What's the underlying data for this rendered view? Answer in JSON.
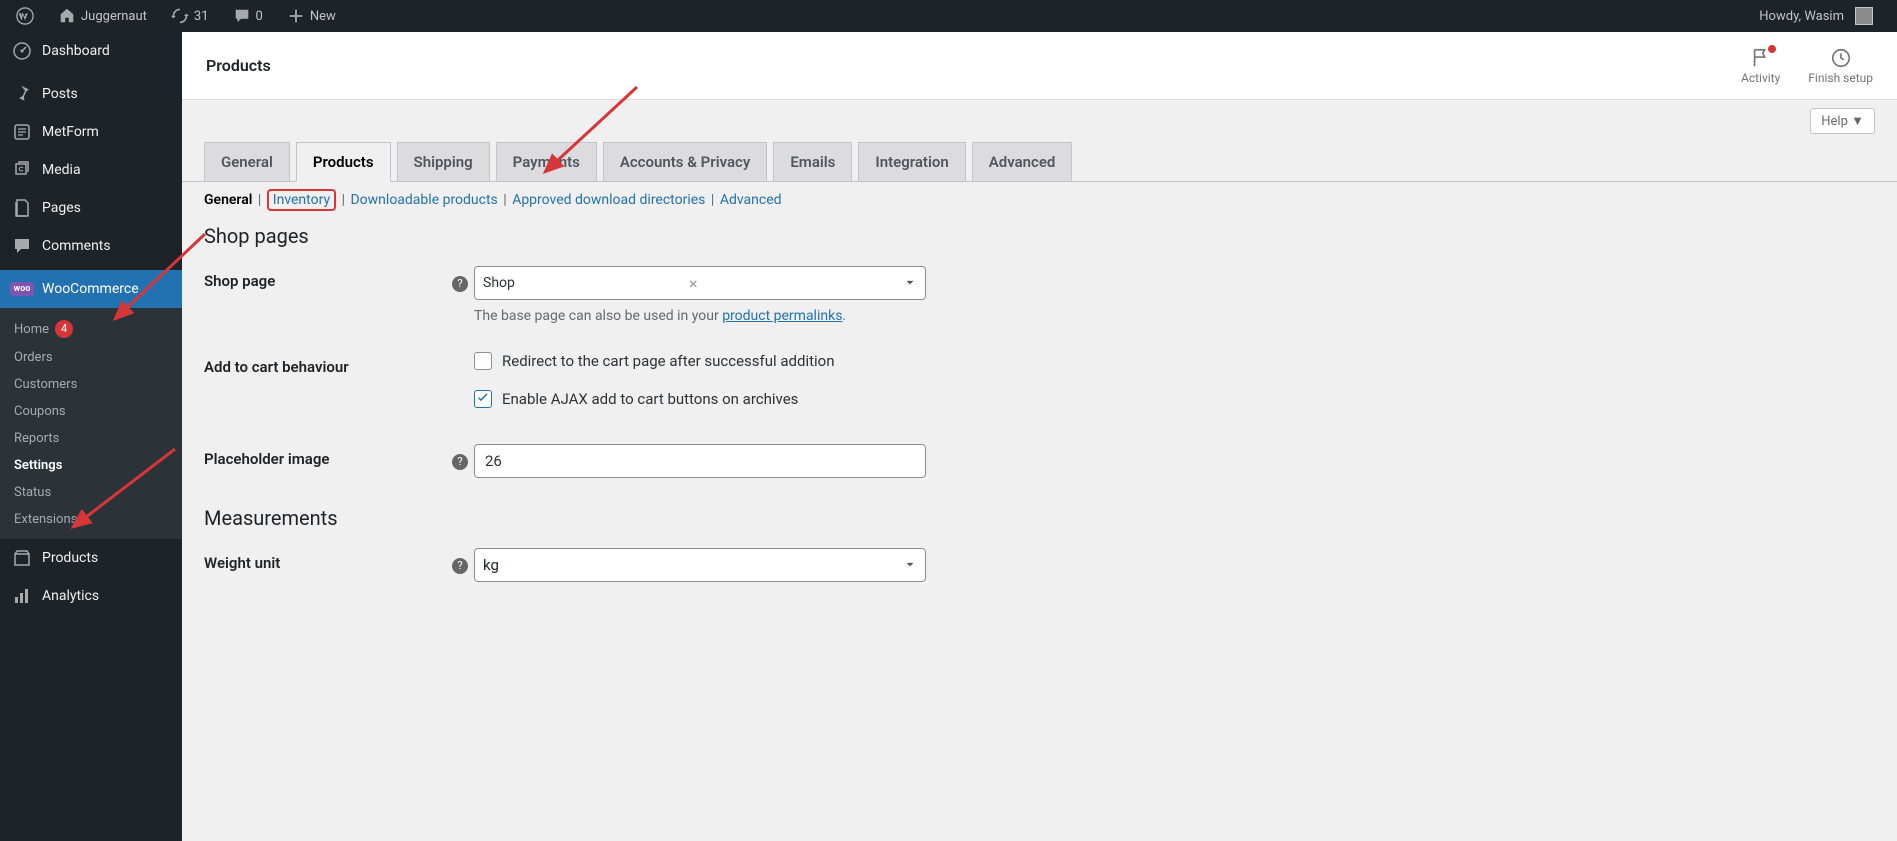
{
  "adminbar": {
    "site_name": "Juggernaut",
    "updates_count": "31",
    "comments_count": "0",
    "new_label": "New",
    "howdy": "Howdy, Wasim"
  },
  "sidebar": {
    "items": [
      {
        "label": "Dashboard",
        "icon": "dashboard"
      },
      {
        "label": "Posts",
        "icon": "pin"
      },
      {
        "label": "MetForm",
        "icon": "form"
      },
      {
        "label": "Media",
        "icon": "media"
      },
      {
        "label": "Pages",
        "icon": "pages"
      },
      {
        "label": "Comments",
        "icon": "comments"
      },
      {
        "label": "WooCommerce",
        "icon": "woo",
        "current": true
      }
    ],
    "woo_submenu": [
      {
        "label": "Home",
        "badge": "4"
      },
      {
        "label": "Orders"
      },
      {
        "label": "Customers"
      },
      {
        "label": "Coupons"
      },
      {
        "label": "Reports"
      },
      {
        "label": "Settings",
        "current": true
      },
      {
        "label": "Status"
      },
      {
        "label": "Extensions"
      }
    ],
    "after_items": [
      {
        "label": "Products",
        "icon": "products"
      },
      {
        "label": "Analytics",
        "icon": "analytics"
      }
    ]
  },
  "header": {
    "title": "Products",
    "activity": "Activity",
    "finish": "Finish setup"
  },
  "help_label": "Help ▼",
  "tabs": [
    "General",
    "Products",
    "Shipping",
    "Payments",
    "Accounts & Privacy",
    "Emails",
    "Integration",
    "Advanced"
  ],
  "active_tab": "Products",
  "subtabs": {
    "general": "General",
    "inventory": "Inventory",
    "downloadable": "Downloadable products",
    "approved": "Approved download directories",
    "advanced": "Advanced"
  },
  "sections": {
    "shop_pages": {
      "heading": "Shop pages",
      "shop_page_label": "Shop page",
      "shop_page_value": "Shop",
      "shop_page_desc_prefix": "The base page can also be used in your ",
      "shop_page_desc_link": "product permalinks",
      "add_to_cart_label": "Add to cart behaviour",
      "cb_redirect": "Redirect to the cart page after successful addition",
      "cb_ajax": "Enable AJAX add to cart buttons on archives",
      "placeholder_label": "Placeholder image",
      "placeholder_value": "26"
    },
    "measurements": {
      "heading": "Measurements",
      "weight_label": "Weight unit",
      "weight_value": "kg"
    }
  }
}
